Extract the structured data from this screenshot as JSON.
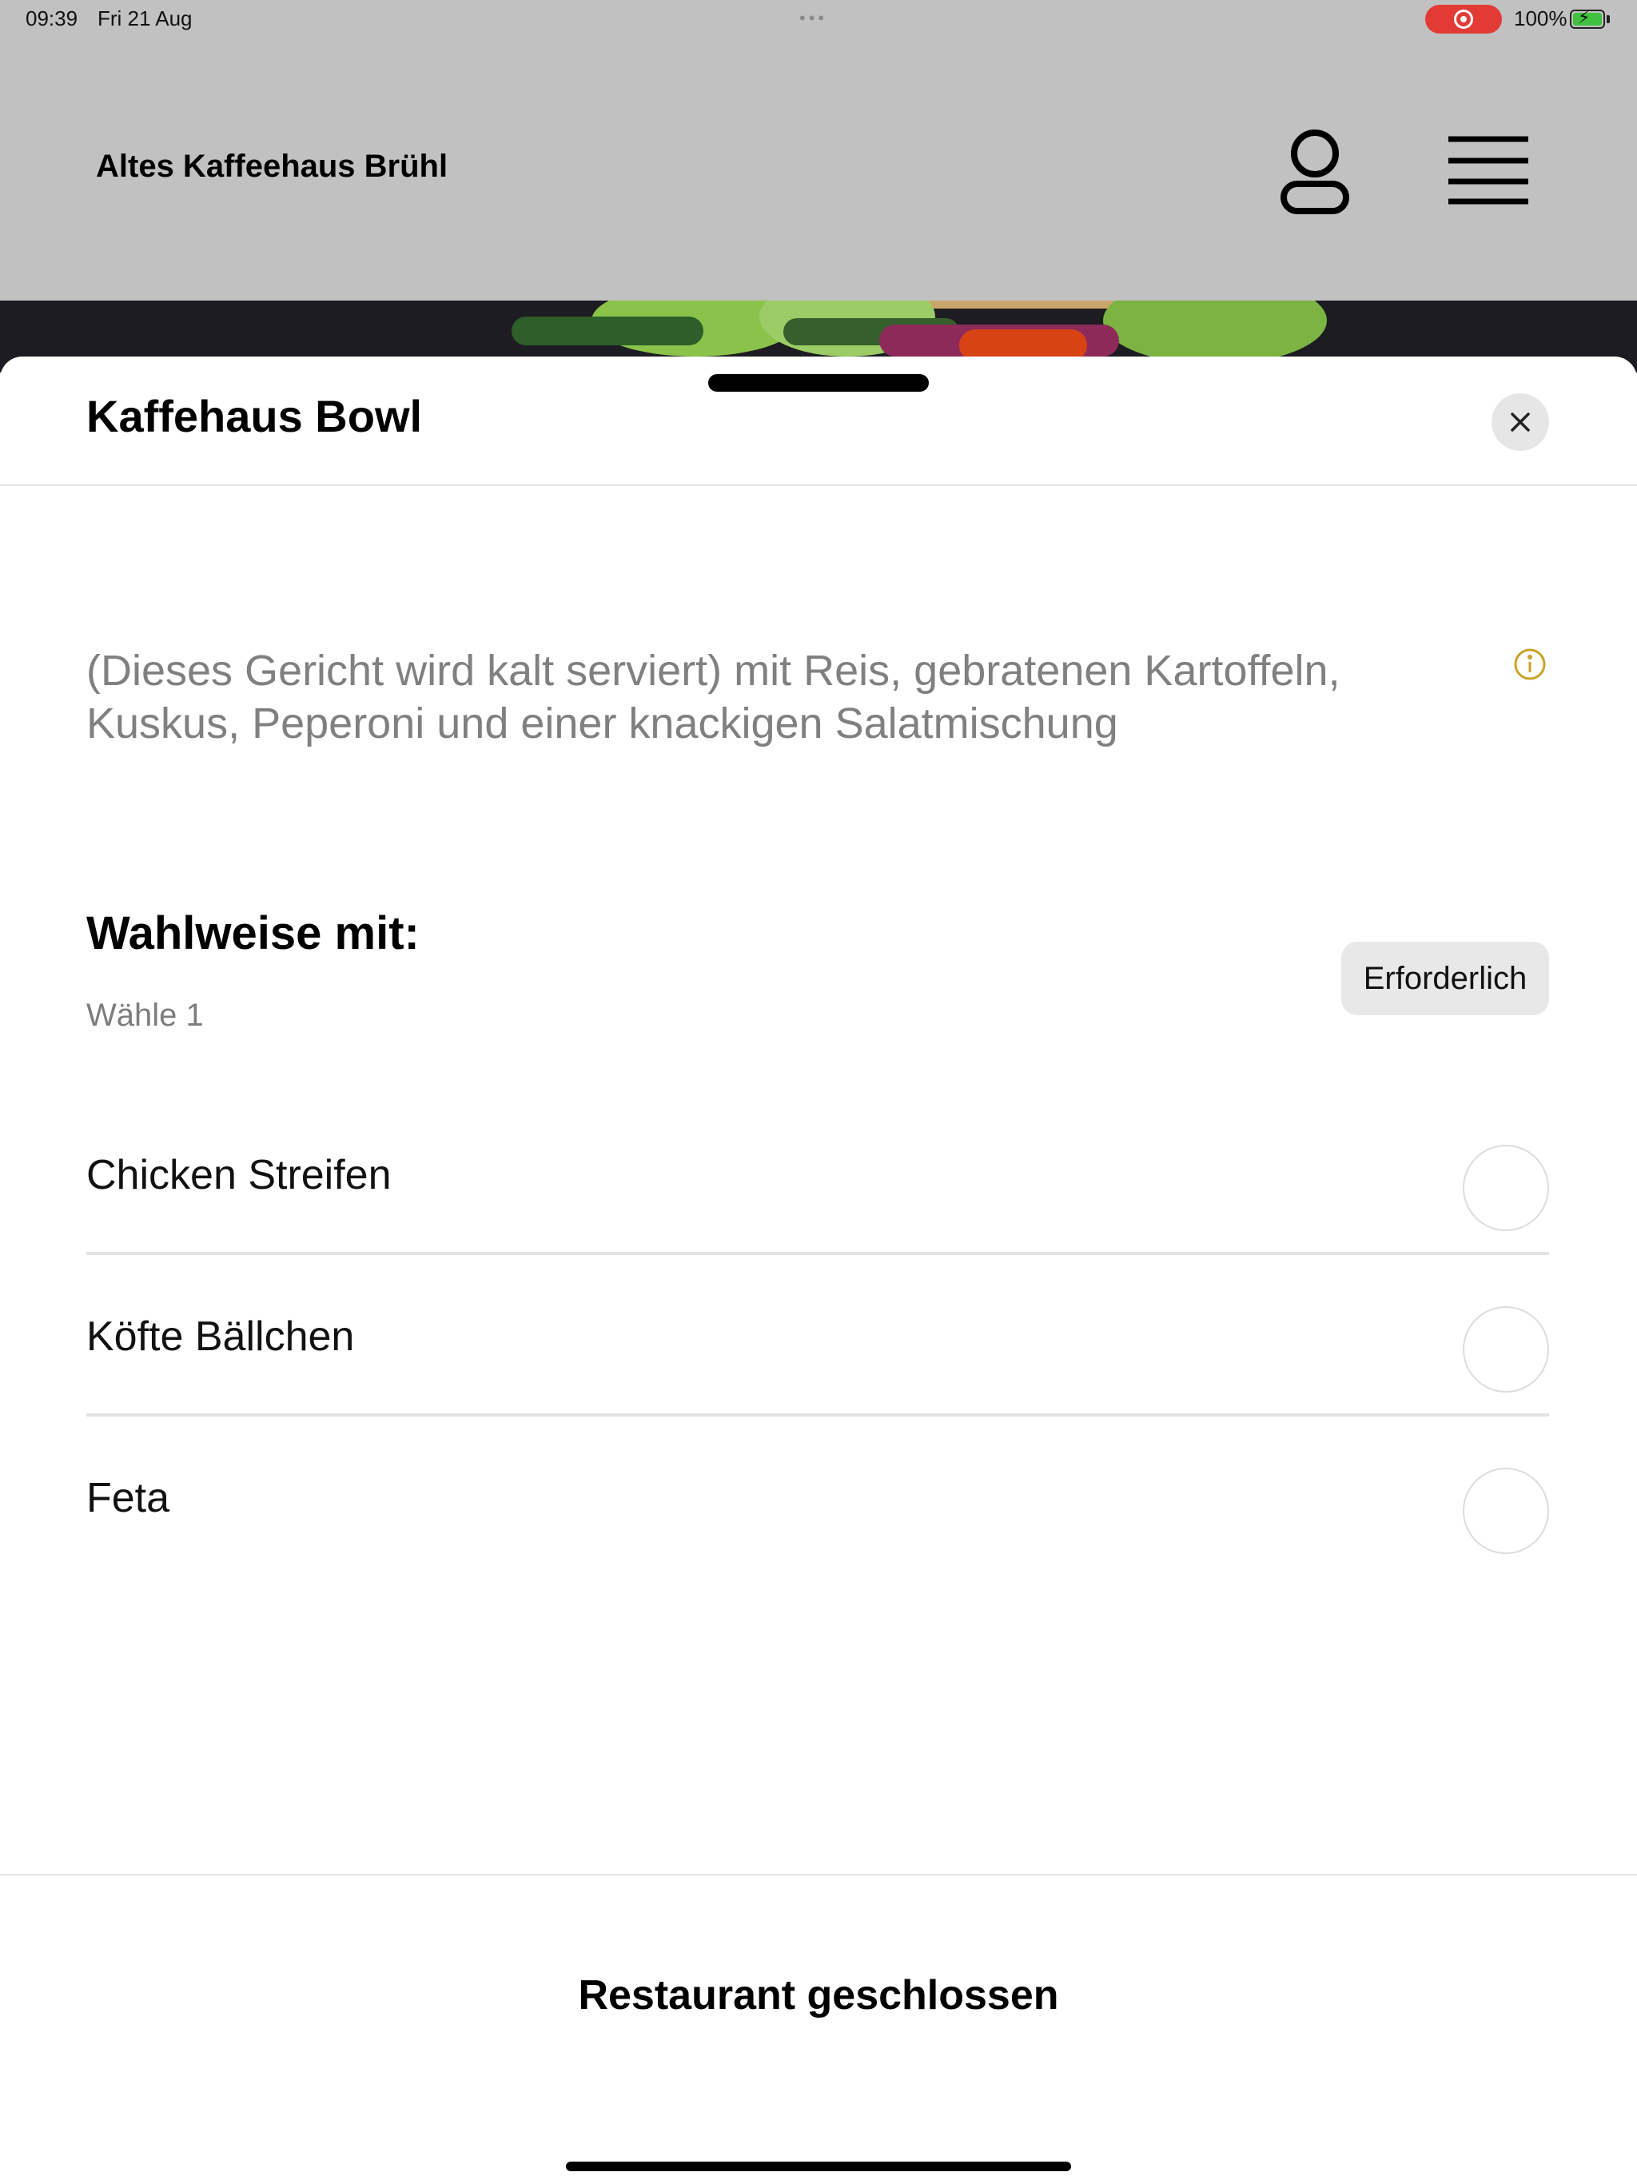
{
  "status_bar": {
    "time": "09:39",
    "date": "Fri 21 Aug",
    "battery": "100%",
    "recording_color": "#e23b36",
    "icons": [
      "more-dots-icon",
      "screen-record-icon",
      "battery-charging-icon"
    ]
  },
  "header": {
    "title": "Altes Kaffeehaus Brühl",
    "icons": [
      "user-icon",
      "hamburger-menu-icon"
    ],
    "background": "#c1c1c1"
  },
  "sheet": {
    "title": "Kaffehaus Bowl",
    "close_icon": "close-icon",
    "description": "(Dieses Gericht wird kalt serviert) mit Reis, gebratenen Kartoffeln, Kuskus, Peperoni und einer knackigen Salatmischung",
    "info_icon": "info-icon",
    "info_color": "#c9a227",
    "option_group": {
      "title": "Wahlweise mit:",
      "subtitle": "Wähle 1",
      "required_label": "Erforderlich",
      "options": [
        {
          "label": "Chicken Streifen",
          "selected": false
        },
        {
          "label": "Köfte Bällchen",
          "selected": false
        },
        {
          "label": "Feta",
          "selected": false
        }
      ]
    },
    "footer_label": "Restaurant geschlossen"
  }
}
